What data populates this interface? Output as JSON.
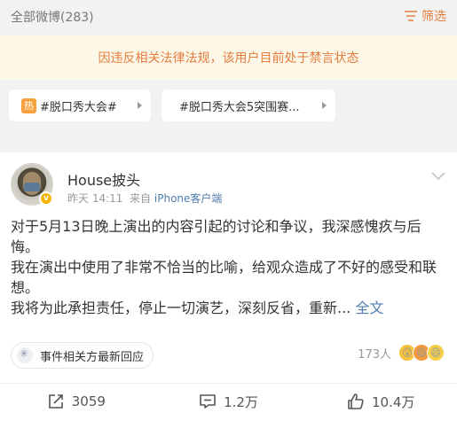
{
  "header": {
    "count_label": "全部微博(283)",
    "filter_label": "筛选"
  },
  "banner": {
    "text": "因违反相关法律法规，该用户目前处于禁言状态"
  },
  "topics": [
    {
      "badge": "热",
      "label": "#脱口秀大会#"
    },
    {
      "label": "#脱口秀大会5突围赛..."
    }
  ],
  "post": {
    "username": "House披头",
    "time": "昨天 14:11",
    "source_prefix": "来自",
    "source": "iPhone客户端",
    "verified_badge": "v",
    "body_lines": [
      "对于5月13日晚上演出的内容引起的讨论和争议，我深感愧疚与后悔。",
      "我在演出中使用了非常不恰当的比喻，给观众造成了不好的感受和联想。",
      "我将为此承担责任，停止一切演艺，深刻反省，重新..."
    ],
    "full_text_link": "全文",
    "event_label": "事件相关方最新回应",
    "reaction_count": "173人",
    "actions": {
      "repost": "3059",
      "comment": "1.2万",
      "like": "10.4万"
    }
  },
  "colors": {
    "accent": "#e47d3f",
    "link": "#507daf",
    "banner_bg": "#fdf7e7"
  },
  "icons": [
    "filter-icon",
    "chevron-down-icon",
    "repost-icon",
    "comment-icon",
    "like-icon"
  ]
}
